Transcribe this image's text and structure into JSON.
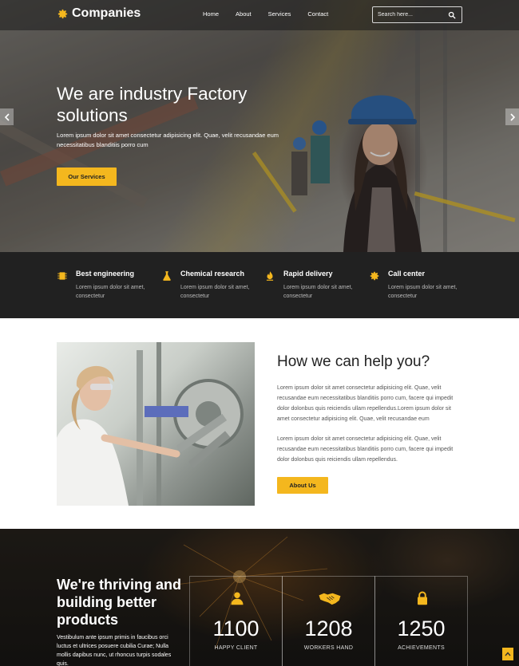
{
  "brand": {
    "name": "Companies",
    "accent": "#f4b71e"
  },
  "nav": [
    "Home",
    "About",
    "Services",
    "Contact"
  ],
  "search": {
    "placeholder": "Search here..."
  },
  "hero": {
    "title": "We are industry Factory solutions",
    "text": "Lorem ipsum dolor sit amet consectetur adipisicing elit. Quae, velit recusandae eum necessitatibus blanditiis porro cum",
    "button": "Our Services"
  },
  "features": [
    {
      "icon": "chip-icon",
      "title": "Best engineering",
      "desc": "Lorem ipsum dolor sit amet, consectetur"
    },
    {
      "icon": "flask-icon",
      "title": "Chemical research",
      "desc": "Lorem ipsum dolor sit amet, consectetur"
    },
    {
      "icon": "flame-icon",
      "title": "Rapid delivery",
      "desc": "Lorem ipsum dolor sit amet, consectetur"
    },
    {
      "icon": "gear-icon",
      "title": "Call center",
      "desc": "Lorem ipsum dolor sit amet, consectetur"
    }
  ],
  "help": {
    "title": "How we can help you?",
    "p1": "Lorem ipsum dolor sit amet consectetur adipisicing elit. Quae, velit recusandae eum necessitatibus blanditiis porro cum, facere qui impedit dolor dolonbus quis reiciendis ullam repellendus.Lorem ipsum dolor sit amet consectetur adipisicing elit. Quae, velit recusandae eum",
    "p2": "Lorem ipsum dolor sit amet consectetur adipisicing elit. Quae, velit recusandae eum necessitatibus blanditiis porro cum, facere qui impedit dolor dolonbus quis reiciendis ullam repellendus.",
    "button": "About Us"
  },
  "stats": {
    "title": "We're thriving and building better products",
    "text": "Vestibulum ante ipsum primis in faucibus orci luctus et ultrices posuere cubilia Curae; Nulla mollis dapibus nunc, ut rhoncus turpis sodales quis.",
    "items": [
      {
        "icon": "user-icon",
        "number": "1100",
        "label": "HAPPY CLIENT"
      },
      {
        "icon": "handshake-icon",
        "number": "1208",
        "label": "WORKERS HAND"
      },
      {
        "icon": "lock-icon",
        "number": "1250",
        "label": "ACHIEVEMENTS"
      }
    ]
  }
}
